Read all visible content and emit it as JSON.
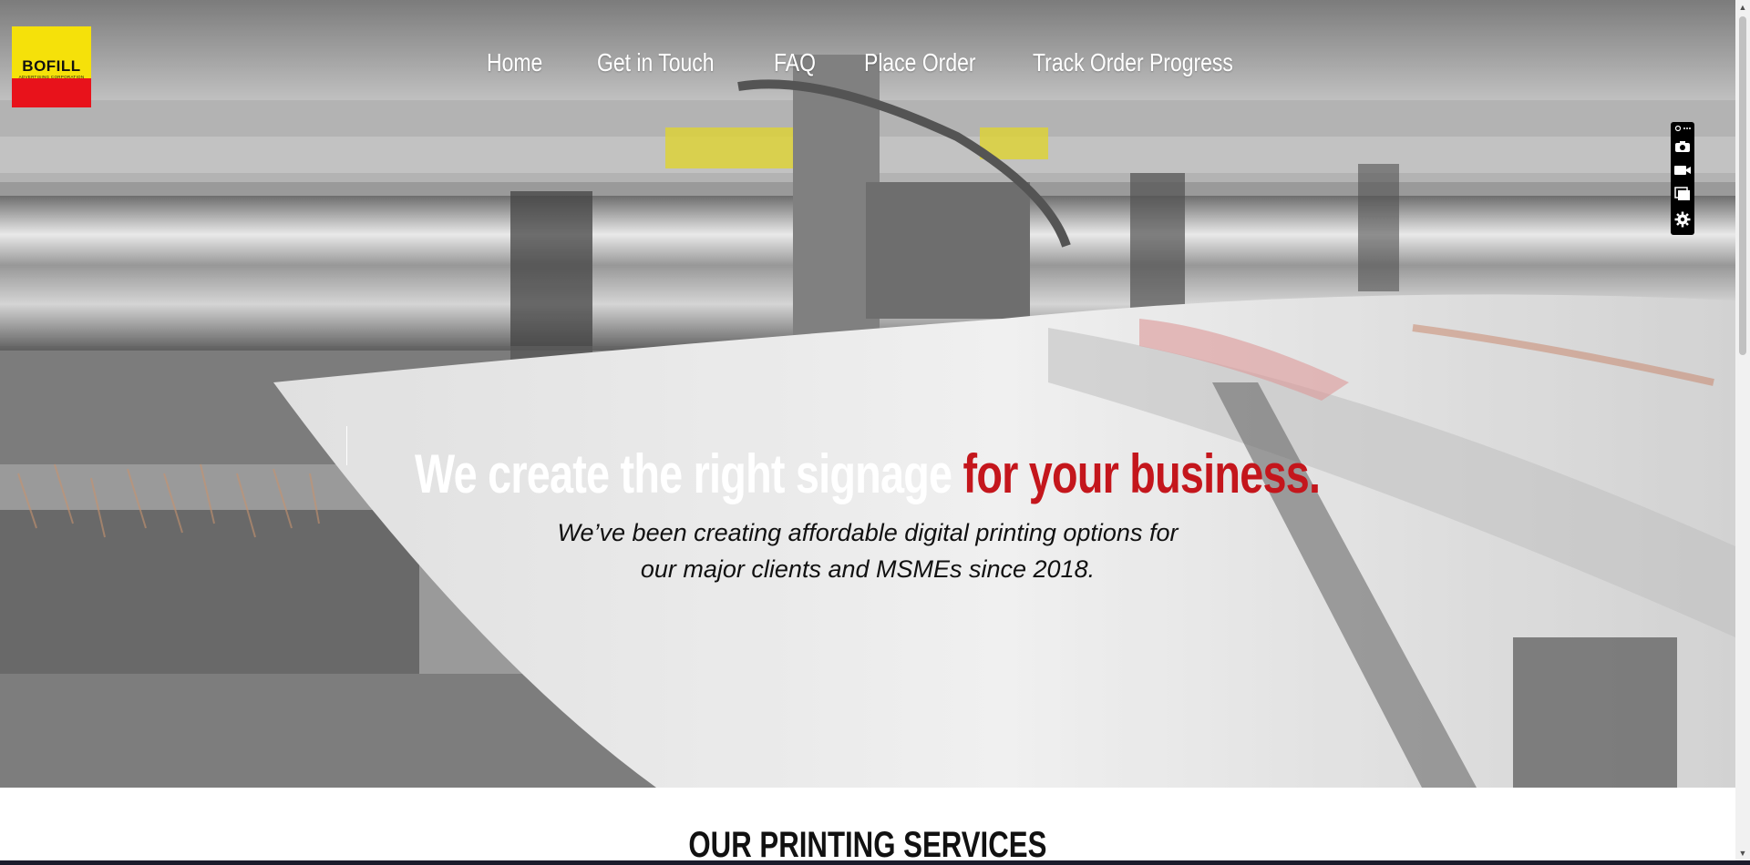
{
  "logo": {
    "word": "BOFILL",
    "tagline": "ADVERTISING CORPORATION"
  },
  "nav": {
    "items": [
      {
        "label": "Home"
      },
      {
        "label": "Get in Touch"
      },
      {
        "label": "FAQ"
      },
      {
        "label": "Place Order"
      },
      {
        "label": "Track Order Progress"
      }
    ]
  },
  "hero": {
    "headline_white": "We create the right signage ",
    "headline_red": "for your business.",
    "subtitle_line1": "We’ve been creating affordable digital printing options for",
    "subtitle_line2": "our major clients and MSMEs since 2018.",
    "background_image": "printing-press-photo"
  },
  "services": {
    "title": "OUR PRINTING SERVICES"
  },
  "toolbar": {
    "icons": [
      "link-more-icon",
      "camera-icon",
      "video-icon",
      "window-icon",
      "settings-icon"
    ]
  },
  "colors": {
    "accent_red": "#c4161c",
    "logo_yellow": "#f5e10a",
    "logo_red": "#e8121b"
  }
}
